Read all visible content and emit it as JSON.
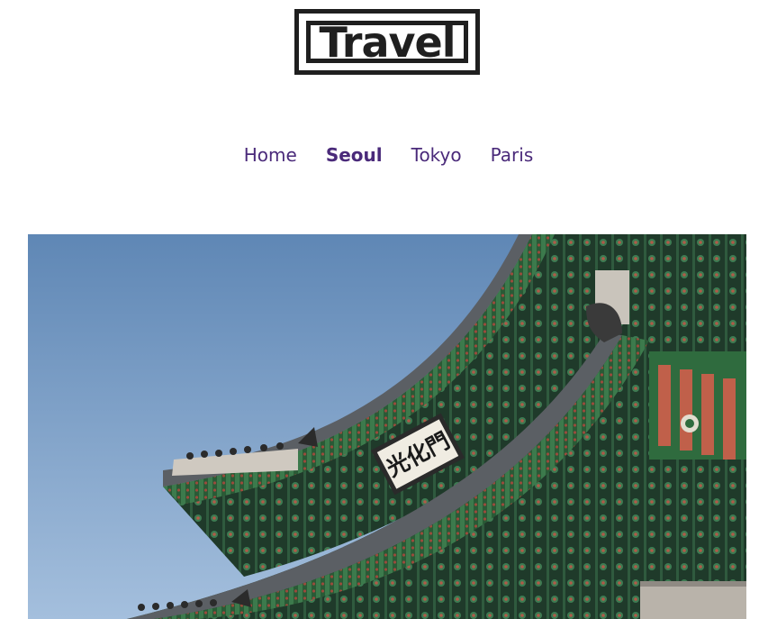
{
  "site": {
    "logo_text": "Travel"
  },
  "nav": {
    "items": [
      {
        "label": "Home",
        "active": false
      },
      {
        "label": "Seoul",
        "active": true
      },
      {
        "label": "Tokyo",
        "active": false
      },
      {
        "label": "Paris",
        "active": false
      }
    ]
  },
  "hero": {
    "signboard_text": "光化門"
  },
  "colors": {
    "nav_link": "#4a2a7a",
    "logo": "#1f1f1f",
    "sky_top": "#5f87b5",
    "sky_bottom": "#a4bfdd",
    "eave_green": "#2f6b3e",
    "eave_red": "#8a3b30"
  }
}
